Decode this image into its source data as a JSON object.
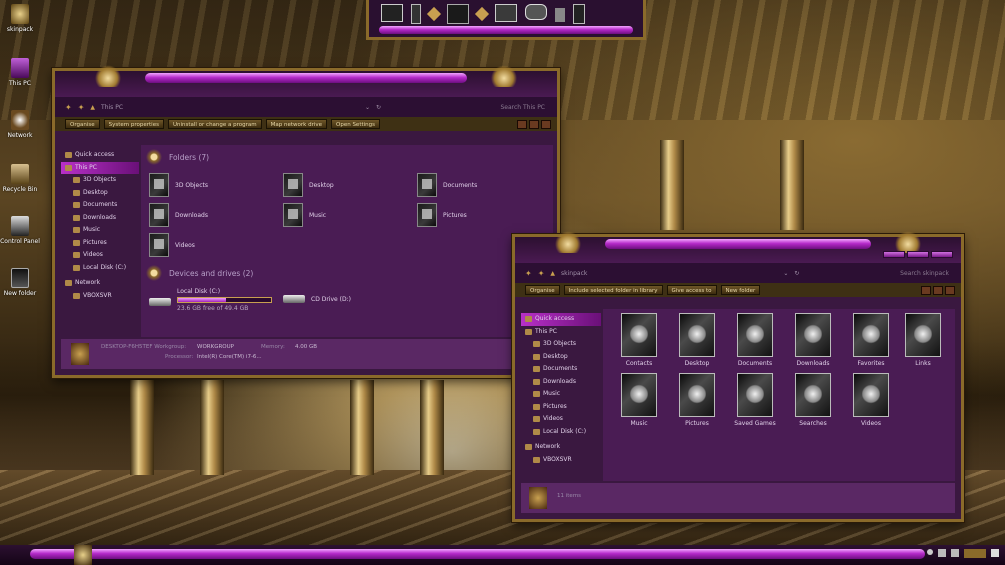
{
  "desktop": {
    "icons": [
      {
        "label": "skinpack",
        "icon": "skinpack-icon"
      },
      {
        "label": "This PC",
        "icon": "this-pc-icon"
      },
      {
        "label": "Network",
        "icon": "network-icon"
      },
      {
        "label": "Recycle Bin",
        "icon": "recycle-bin-icon"
      },
      {
        "label": "Control Panel",
        "icon": "control-panel-icon"
      },
      {
        "label": "New folder",
        "icon": "folder-icon"
      }
    ]
  },
  "win1": {
    "path": "This PC",
    "search_placeholder": "Search This PC",
    "toolbar": [
      "Organise",
      "System properties",
      "Uninstall or change a program",
      "Map network drive",
      "Open Settings"
    ],
    "nav": [
      {
        "label": "Quick access",
        "level": 0
      },
      {
        "label": "This PC",
        "level": 0,
        "selected": true
      },
      {
        "label": "3D Objects",
        "level": 1
      },
      {
        "label": "Desktop",
        "level": 1
      },
      {
        "label": "Documents",
        "level": 1
      },
      {
        "label": "Downloads",
        "level": 1
      },
      {
        "label": "Music",
        "level": 1
      },
      {
        "label": "Pictures",
        "level": 1
      },
      {
        "label": "Videos",
        "level": 1
      },
      {
        "label": "Local Disk (C:)",
        "level": 1
      },
      {
        "label": "Network",
        "level": 0
      },
      {
        "label": "VBOXSVR",
        "level": 1
      }
    ],
    "folders_header": "Folders (7)",
    "folders": [
      "3D Objects",
      "Desktop",
      "Documents",
      "Downloads",
      "Music",
      "Pictures",
      "Videos"
    ],
    "drives_header": "Devices and drives (2)",
    "drives": [
      {
        "name": "Local Disk (C:)",
        "free": "23.6 GB free of 49.4 GB",
        "used_fraction": 0.52
      },
      {
        "name": "CD Drive (D:)"
      }
    ],
    "details": {
      "line1_a": "DESKTOP-F6H5TEF Workgroup:",
      "line1_b": "WORKGROUP",
      "line1_c": "Memory:",
      "line1_d": "4.00 GB",
      "line2_a": "Processor:",
      "line2_b": "Intel(R) Core(TM) i7-6..."
    }
  },
  "win2": {
    "path": "skinpack",
    "search_placeholder": "Search skinpack",
    "toolbar": [
      "Organise",
      "Include selected folder in library",
      "Give access to",
      "New folder"
    ],
    "nav": [
      {
        "label": "Quick access",
        "level": 0,
        "selected": true
      },
      {
        "label": "This PC",
        "level": 0
      },
      {
        "label": "3D Objects",
        "level": 1
      },
      {
        "label": "Desktop",
        "level": 1
      },
      {
        "label": "Documents",
        "level": 1
      },
      {
        "label": "Downloads",
        "level": 1
      },
      {
        "label": "Music",
        "level": 1
      },
      {
        "label": "Pictures",
        "level": 1
      },
      {
        "label": "Videos",
        "level": 1
      },
      {
        "label": "Local Disk (C:)",
        "level": 1
      },
      {
        "label": "Network",
        "level": 0
      },
      {
        "label": "VBOXSVR",
        "level": 1
      }
    ],
    "items": [
      "Contacts",
      "Desktop",
      "Documents",
      "Downloads",
      "Favorites",
      "Links",
      "Music",
      "Pictures",
      "Saved Games",
      "Searches",
      "Videos"
    ],
    "status": "11 items"
  },
  "colors": {
    "accent": "#b52ac9",
    "gold": "#c8a050",
    "bg": "#3a1840"
  }
}
